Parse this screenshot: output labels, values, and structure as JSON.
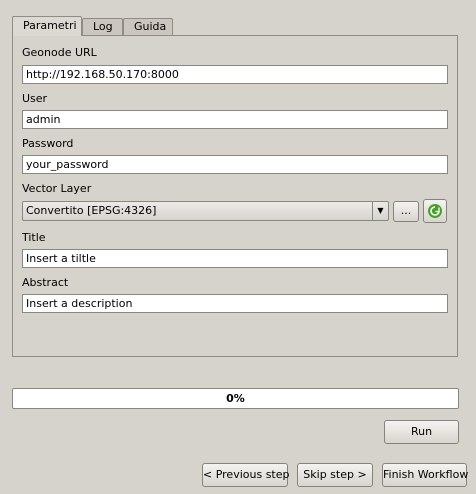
{
  "tabs": [
    {
      "label": "Parametri",
      "active": true
    },
    {
      "label": "Log",
      "active": false
    },
    {
      "label": "Guida",
      "active": false
    }
  ],
  "form": {
    "geonode_url": {
      "label": "Geonode URL",
      "value": "http://192.168.50.170:8000"
    },
    "user": {
      "label": "User",
      "value": "admin"
    },
    "password": {
      "label": "Password",
      "value": "your_password"
    },
    "vector_layer": {
      "label": "Vector Layer",
      "value": "Convertito [EPSG:4326]",
      "browse_label": "..."
    },
    "title": {
      "label": "Title",
      "value": "Insert a tiltle"
    },
    "abstract": {
      "label": "Abstract",
      "value": "Insert a description"
    }
  },
  "progress": {
    "text": "0%",
    "fraction": 0
  },
  "buttons": {
    "run": "Run",
    "previous": "< Previous step",
    "skip": "Skip step >",
    "finish": "Finish Workflow"
  },
  "icons": {
    "refresh": "refresh-icon",
    "dropdown": "chevron-down-icon"
  },
  "colors": {
    "background": "#d6d2cc",
    "refresh_icon": "#4aa02c"
  }
}
